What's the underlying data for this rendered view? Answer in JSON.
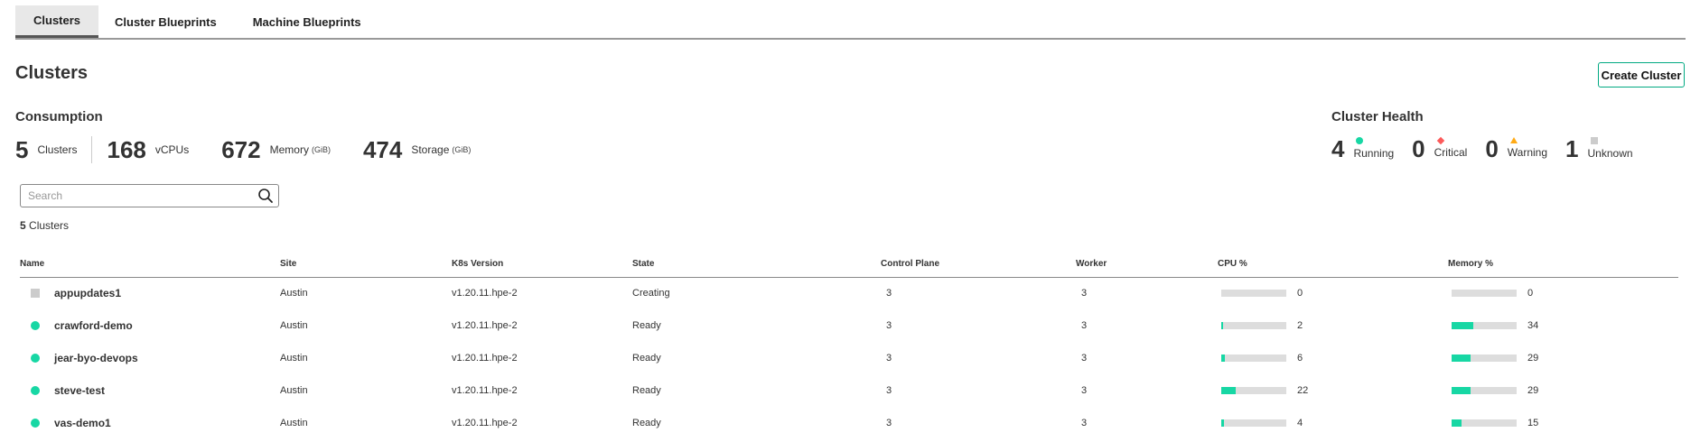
{
  "tabs": [
    {
      "label": "Clusters",
      "active": true
    },
    {
      "label": "Cluster Blueprints",
      "active": false
    },
    {
      "label": "Machine Blueprints",
      "active": false
    }
  ],
  "page_title": "Clusters",
  "create_button_label": "Create Cluster",
  "consumption": {
    "heading": "Consumption",
    "metrics": [
      {
        "value": "5",
        "label": "Clusters",
        "unit": ""
      },
      {
        "value": "168",
        "label": "vCPUs",
        "unit": ""
      },
      {
        "value": "672",
        "label": "Memory",
        "unit": "(GiB)"
      },
      {
        "value": "474",
        "label": "Storage",
        "unit": "(GiB)"
      }
    ]
  },
  "health": {
    "heading": "Cluster Health",
    "items": [
      {
        "value": "4",
        "label": "Running",
        "indicator": "running-dot-icon",
        "color": "#17d7a4"
      },
      {
        "value": "0",
        "label": "Critical",
        "indicator": "critical-diamond-icon",
        "color": "#fc5a5a"
      },
      {
        "value": "0",
        "label": "Warning",
        "indicator": "warning-triangle-icon",
        "color": "#ffaa15"
      },
      {
        "value": "1",
        "label": "Unknown",
        "indicator": "unknown-square-icon",
        "color": "#cccccc"
      }
    ]
  },
  "search": {
    "placeholder": "Search",
    "value": "",
    "icon": "search-icon"
  },
  "cluster_count": {
    "number": "5",
    "label": "Clusters"
  },
  "table": {
    "columns": [
      "Name",
      "Site",
      "K8s Version",
      "State",
      "Control Plane",
      "Worker",
      "CPU %",
      "Memory %"
    ],
    "rows": [
      {
        "status": "creating",
        "name": "appupdates1",
        "site": "Austin",
        "version": "v1.20.11.hpe-2",
        "state": "Creating",
        "control_plane": "3",
        "worker": "3",
        "cpu": 0,
        "memory": 0
      },
      {
        "status": "ready",
        "name": "crawford-demo",
        "site": "Austin",
        "version": "v1.20.11.hpe-2",
        "state": "Ready",
        "control_plane": "3",
        "worker": "3",
        "cpu": 2,
        "memory": 34
      },
      {
        "status": "ready",
        "name": "jear-byo-devops",
        "site": "Austin",
        "version": "v1.20.11.hpe-2",
        "state": "Ready",
        "control_plane": "3",
        "worker": "3",
        "cpu": 6,
        "memory": 29
      },
      {
        "status": "ready",
        "name": "steve-test",
        "site": "Austin",
        "version": "v1.20.11.hpe-2",
        "state": "Ready",
        "control_plane": "3",
        "worker": "3",
        "cpu": 22,
        "memory": 29
      },
      {
        "status": "ready",
        "name": "vas-demo1",
        "site": "Austin",
        "version": "v1.20.11.hpe-2",
        "state": "Ready",
        "control_plane": "3",
        "worker": "3",
        "cpu": 4,
        "memory": 15
      }
    ]
  },
  "colors": {
    "accent": "#17d7a4",
    "button_border": "#01a982",
    "bar_track": "#dddddd"
  }
}
